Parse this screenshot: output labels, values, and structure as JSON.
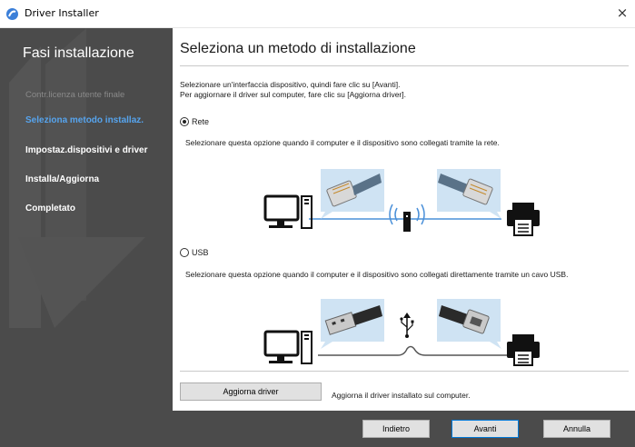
{
  "window": {
    "title": "Driver Installer",
    "close_glyph": "×"
  },
  "sidebar": {
    "title": "Fasi installazione",
    "steps": [
      {
        "label": "Contr.licenza utente finale",
        "state": "done"
      },
      {
        "label": "Seleziona metodo installaz.",
        "state": "active"
      },
      {
        "label": "Impostaz.dispositivi e driver",
        "state": "pending"
      },
      {
        "label": "Installa/Aggiorna",
        "state": "pending"
      },
      {
        "label": "Completato",
        "state": "pending"
      }
    ]
  },
  "main": {
    "heading": "Seleziona un metodo di installazione",
    "intro_line1": "Selezionare un'interfaccia dispositivo, quindi fare clic su [Avanti].",
    "intro_line2": "Per aggiornare il driver sul computer, fare clic su [Aggiorna driver].",
    "options": [
      {
        "label": "Rete",
        "selected": true,
        "description": "Selezionare questa opzione quando il computer e il dispositivo sono collegati tramite la rete."
      },
      {
        "label": "USB",
        "selected": false,
        "description": "Selezionare questa opzione quando il computer e il dispositivo sono collegati direttamente tramite un cavo USB."
      }
    ],
    "update_button": "Aggiorna driver",
    "update_note": "Aggiorna il driver installato sul computer."
  },
  "footer": {
    "back_label": "Indietro",
    "next_label": "Avanti",
    "cancel_label": "Annulla"
  },
  "colors": {
    "sidebar_bg": "#4b4b4b",
    "active_step": "#56a4ee",
    "accent": "#0078d7",
    "illustration_blue": "#cfe3f3"
  },
  "icons": {
    "app": "driver-installer-icon",
    "network_connector": "rj45-icon",
    "usb_connector": "usb-a-icon",
    "printer_connector": "usb-b-icon",
    "computer": "desktop-computer-icon",
    "printer": "printer-icon",
    "router": "wireless-router-icon",
    "usb_symbol": "usb-symbol-icon"
  }
}
